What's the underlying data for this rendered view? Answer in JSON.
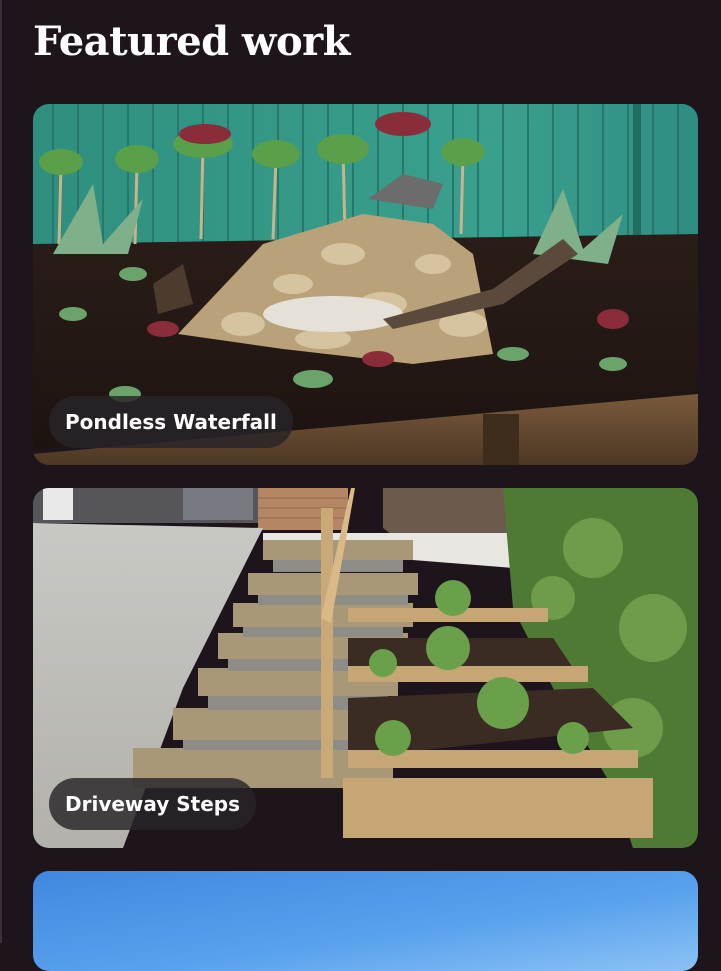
{
  "section": {
    "title": "Featured work"
  },
  "projects": [
    {
      "caption": "Pondless Waterfall",
      "image": "garden-waterfall-photo"
    },
    {
      "caption": "Driveway Steps",
      "image": "timber-steps-photo"
    },
    {
      "caption": "",
      "image": "sky-photo"
    }
  ],
  "colors": {
    "background": "#1d141c",
    "title": "#ffffff",
    "caption_bg": "#282428"
  }
}
